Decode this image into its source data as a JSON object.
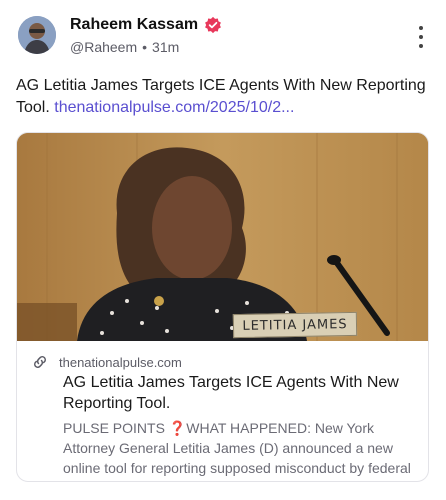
{
  "post": {
    "author_name": "Raheem Kassam",
    "handle": "@Raheem",
    "separator": "•",
    "time": "31m",
    "text": "AG Letitia James Targets ICE Agents With New Reporting Tool. ",
    "link": "thenationalpulse.com/2025/10/2..."
  },
  "card": {
    "domain": "thenationalpulse.com",
    "title": "AG Letitia James Targets ICE Agents With New Reporting Tool.",
    "description": "PULSE POINTS ❓WHAT HAPPENED: New York Attorney General Letitia James (D) announced a new online tool for reporting supposed misconduct by federal",
    "image_nameplate": "LETITIA JAMES"
  },
  "icons": {
    "verified": "verified-badge-icon",
    "more": "more-vertical-icon",
    "link": "link-icon"
  },
  "colors": {
    "link": "#5a4fd0",
    "verified": "#e8385b",
    "muted": "#5c5c66"
  }
}
